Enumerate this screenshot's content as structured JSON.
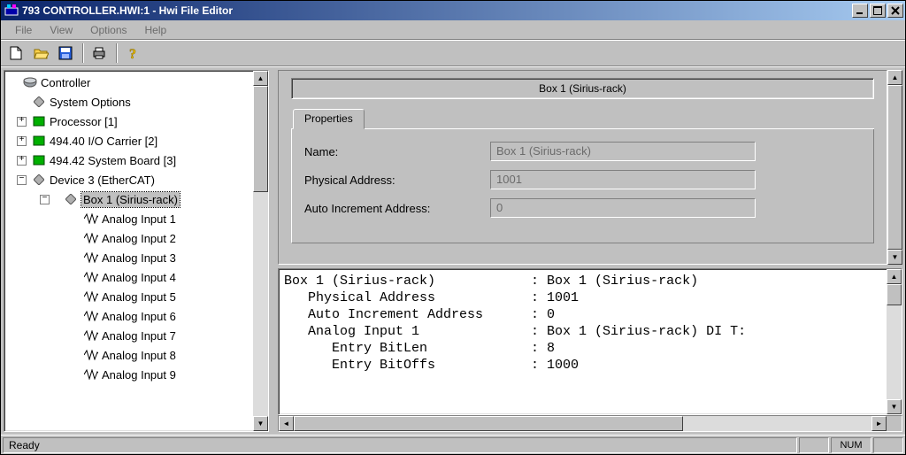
{
  "title": "793 CONTROLLER.HWI:1 - Hwi File Editor",
  "menu": {
    "file": "File",
    "view": "View",
    "options": "Options",
    "help": "Help"
  },
  "tree": {
    "root": "Controller",
    "sysopts": "System Options",
    "processor": "Processor [1]",
    "iocarrier": "494.40 I/O Carrier [2]",
    "sysboard": "494.42 System Board [3]",
    "device3": "Device 3 (EtherCAT)",
    "box1": "Box 1 (Sirius-rack)",
    "ai1": "Analog Input 1",
    "ai2": "Analog Input 2",
    "ai3": "Analog Input 3",
    "ai4": "Analog Input 4",
    "ai5": "Analog Input 5",
    "ai6": "Analog Input 6",
    "ai7": "Analog Input 7",
    "ai8": "Analog Input 8",
    "ai9": "Analog Input 9"
  },
  "props": {
    "header": "Box 1 (Sirius-rack)",
    "tab": "Properties",
    "name_label": "Name:",
    "name_value": "Box 1 (Sirius-rack)",
    "paddr_label": "Physical Address:",
    "paddr_value": "1001",
    "aincr_label": "Auto Increment Address:",
    "aincr_value": "0"
  },
  "details": {
    "l1": "Box 1 (Sirius-rack)            : Box 1 (Sirius-rack)",
    "l2": "   Physical Address            : 1001",
    "l3": "   Auto Increment Address      : 0",
    "l4": "   Analog Input 1              : Box 1 (Sirius-rack) DI T:",
    "l5": "      Entry BitLen             : 8",
    "l6": "      Entry BitOffs            : 1000"
  },
  "status": {
    "ready": "Ready",
    "num": "NUM"
  },
  "colors": {
    "titlebar_start": "#0A246A",
    "titlebar_end": "#A6CAF0",
    "face": "#C0C0C0"
  }
}
